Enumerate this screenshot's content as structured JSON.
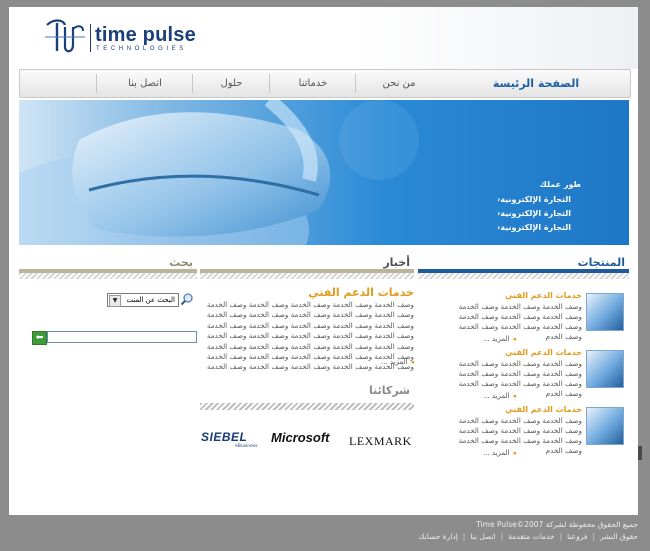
{
  "brand": {
    "name": "time pulse",
    "tagline": "TECHNOLOGIES"
  },
  "nav": {
    "items": [
      {
        "label": "الصفحة الرئيسة",
        "active": true
      },
      {
        "label": "من نحن",
        "active": false
      },
      {
        "label": "خدماتنا",
        "active": false
      },
      {
        "label": "حلول",
        "active": false
      },
      {
        "label": "اتصل بنا",
        "active": false
      }
    ]
  },
  "banner": {
    "title": "طور عملك",
    "items": [
      "التجارة الإلكترونية",
      "التجارة الإلكترونية",
      "التجارة الإلكترونية"
    ]
  },
  "sections": {
    "products_title": "المنتجات",
    "news_title": "أخبار",
    "search_title": "بحث",
    "partners_title": "شركائنا"
  },
  "products": [
    {
      "title": "خدمات الدعم الفني",
      "body": "وصف الخدمة وصف الخدمة وصف الخدمة وصف الخدمة وصف الخدمة وصف الخدمة وصف الخدمة وصف الخدمة وصف الخدمة وصف الخدم",
      "more": "المزيد ..."
    },
    {
      "title": "خدمات الدعم الفني",
      "body": "وصف الخدمة وصف الخدمة وصف الخدمة وصف الخدمة وصف الخدمة وصف الخدمة وصف الخدمة وصف الخدمة وصف الخدمة وصف الخدم",
      "more": "المزيد ..."
    },
    {
      "title": "خدمات الدعم الفني",
      "body": "وصف الخدمة وصف الخدمة وصف الخدمة وصف الخدمة وصف الخدمة وصف الخدمة وصف الخدمة وصف الخدمة وصف الخدمة وصف الخدم",
      "more": "المزيد ..."
    }
  ],
  "news": {
    "title": "خدمات الدعم الفني",
    "body": "وصف الخدمة وصف الخدمة وصف الخدمة وصف الخدمة وصف الخدمة وصف الخدمة وصف الخدمة وصف الخدمة وصف الخدمة وصف الخدمة وصف الخدمة وصف الخدمة وصف الخدمة وصف الخدمة وصف الخدمة وصف الخدمة وصف الخدمة وصف الخدمة وصف الخدمة وصف الخدمة وصف الخدمة وصف الخدمة وصف الخدمة وصف الخدمة وصف الخدمة وصف الخدمة وصف الخدمة وصف الخدمة وصف الخدمة وصف الخدمة وصف الخدمة وصف الخدمة وصف الخدمة وصف الخدمة وصف الخدمة",
    "more": "المزيد ..."
  },
  "partners": {
    "siebel": "SIEBEL",
    "siebel_sub": "eBusiness",
    "microsoft": "Microsoft",
    "lexmark": "LEXMARK"
  },
  "search": {
    "select_value": "البحث عن المنت",
    "input_value": ""
  },
  "footer": {
    "copyright": "جميع الحقوق محفوظة لشركة Time Pulse©2007",
    "links": [
      "حقوق النشر",
      "فروعنا",
      "خدمات متقدمة",
      "اتصل بنا",
      "إدارة حسابك"
    ]
  },
  "colors": {
    "accent_blue": "#1b5fa3",
    "accent_orange": "#e39a1a",
    "products_bar": "#1f5a9a",
    "news_bar": "#b9b49a",
    "search_bar": "#b9b49a"
  }
}
